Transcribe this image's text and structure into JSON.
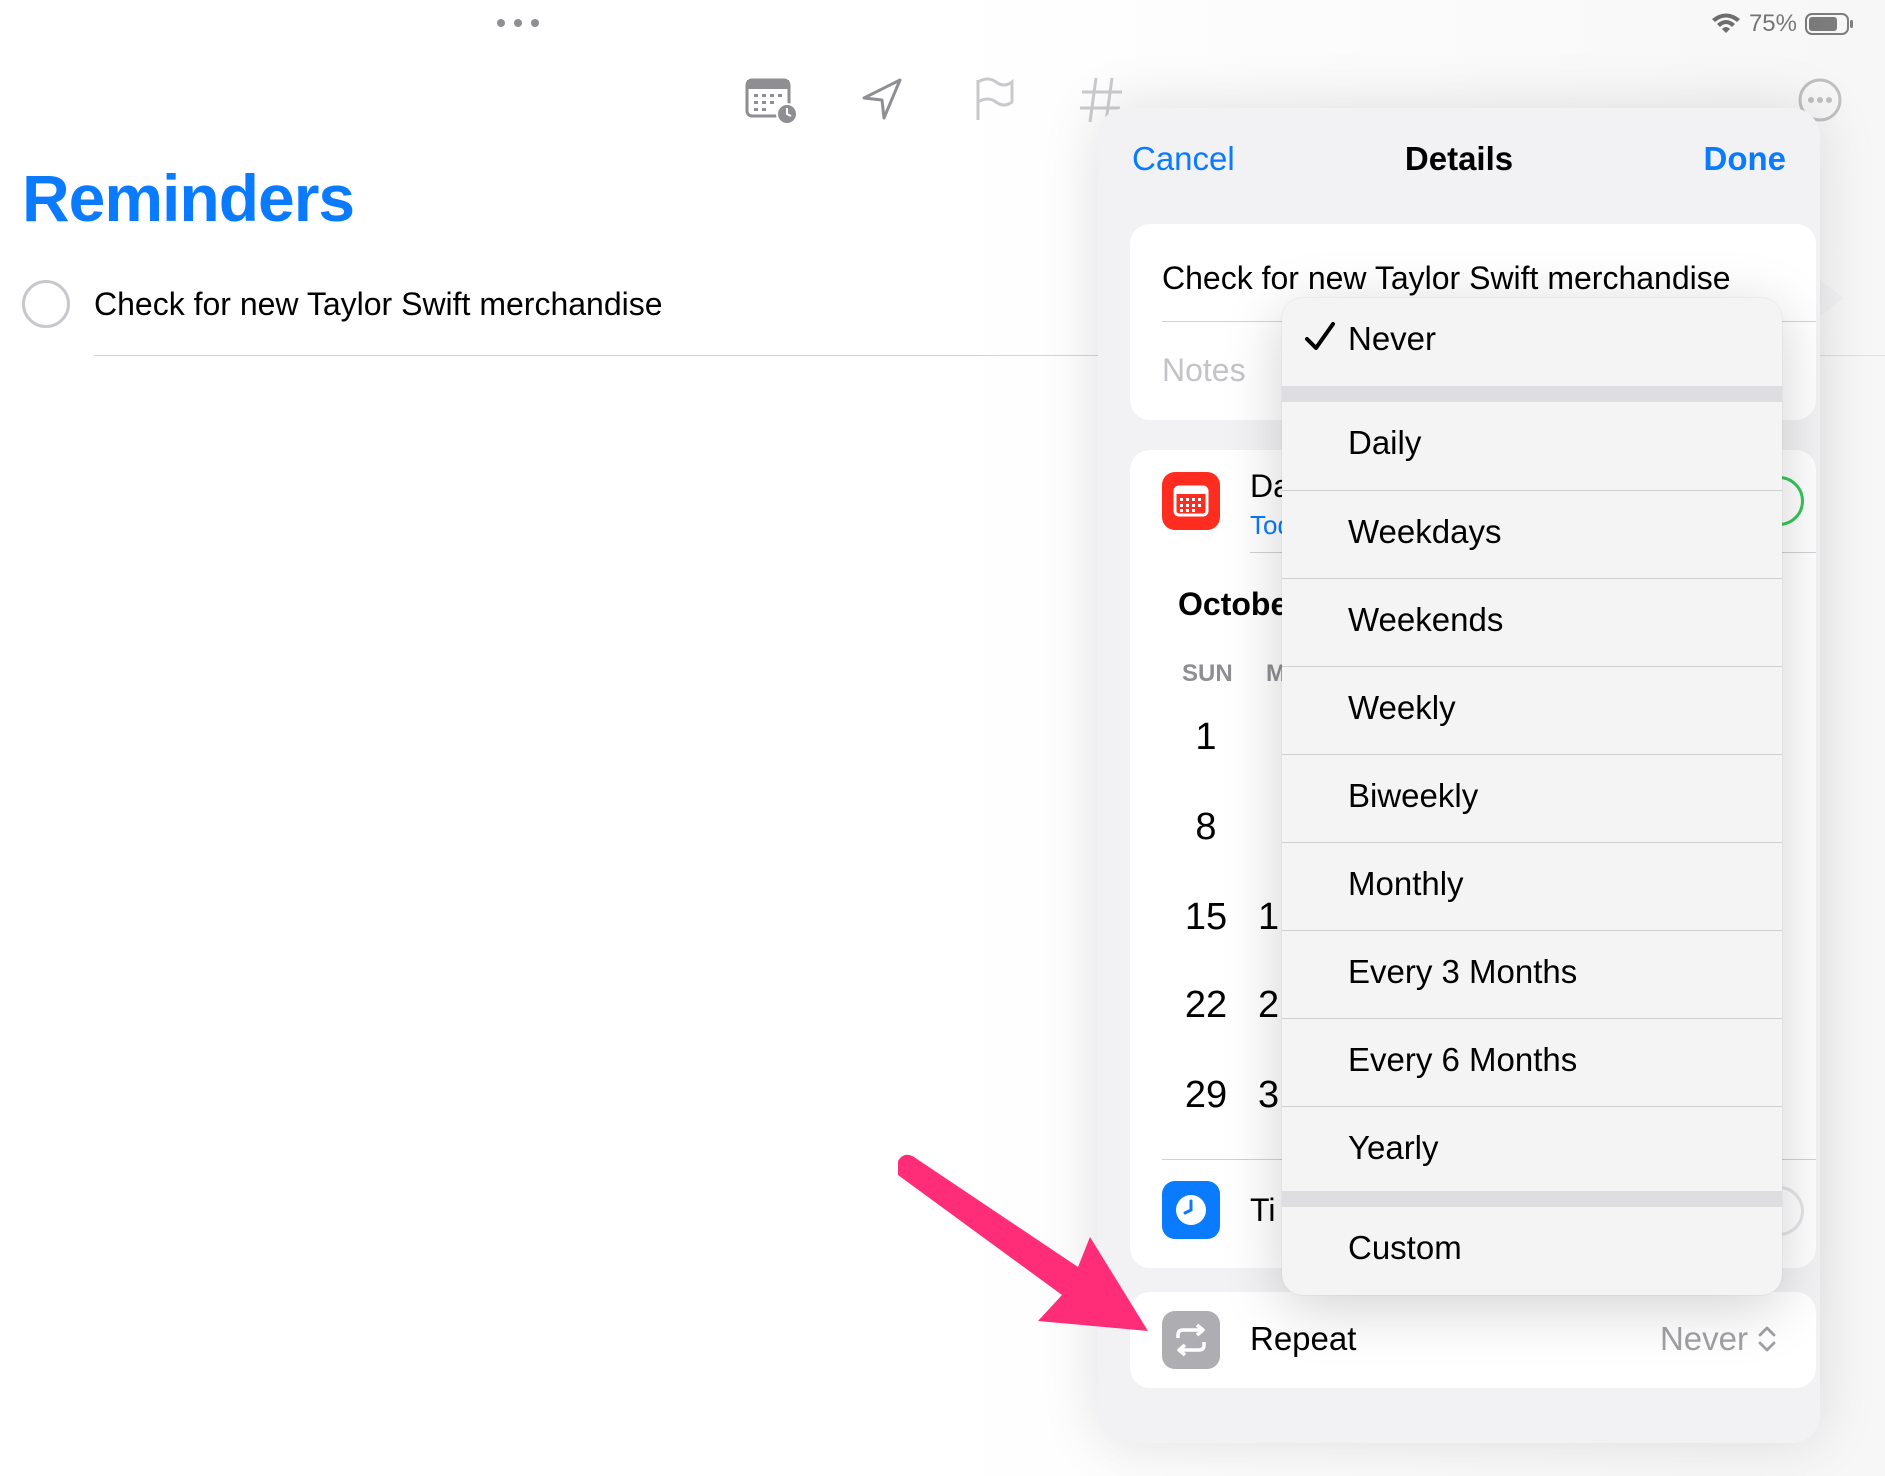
{
  "status_bar": {
    "battery_percent": "75%"
  },
  "toolbar": {
    "icons": [
      "calendar-clock-icon",
      "location-arrow-icon",
      "flag-icon",
      "hashtag-icon",
      "more-circle-icon"
    ]
  },
  "list": {
    "title": "Reminders",
    "items": [
      {
        "text": "Check for new Taylor Swift merchandise",
        "completed": false
      }
    ]
  },
  "details": {
    "cancel_label": "Cancel",
    "title": "Details",
    "done_label": "Done",
    "reminder_title": "Check for new Taylor Swift merchandise",
    "notes_placeholder": "Notes",
    "date_label_visible": "Da",
    "date_sub_visible": "Tod",
    "month_visible": "Octobe",
    "weekdays_visible": [
      "SUN",
      "M"
    ],
    "sunday_dates": [
      "1",
      "8",
      "15",
      "22",
      "29"
    ],
    "monday_partial": [
      "1",
      "2",
      "3"
    ],
    "time_label_visible": "Ti",
    "repeat_label": "Repeat",
    "repeat_value": "Never"
  },
  "repeat_menu": {
    "selected": "Never",
    "items": [
      "Never",
      "Daily",
      "Weekdays",
      "Weekends",
      "Weekly",
      "Biweekly",
      "Monthly",
      "Every 3 Months",
      "Every 6 Months",
      "Yearly",
      "Custom"
    ]
  },
  "colors": {
    "accent_blue": "#0a7aff",
    "calendar_red": "#ff2d1f",
    "toggle_green": "#34c759",
    "arrow_pink": "#ff2d78",
    "repeat_icon_gray": "#aeaeb2"
  }
}
